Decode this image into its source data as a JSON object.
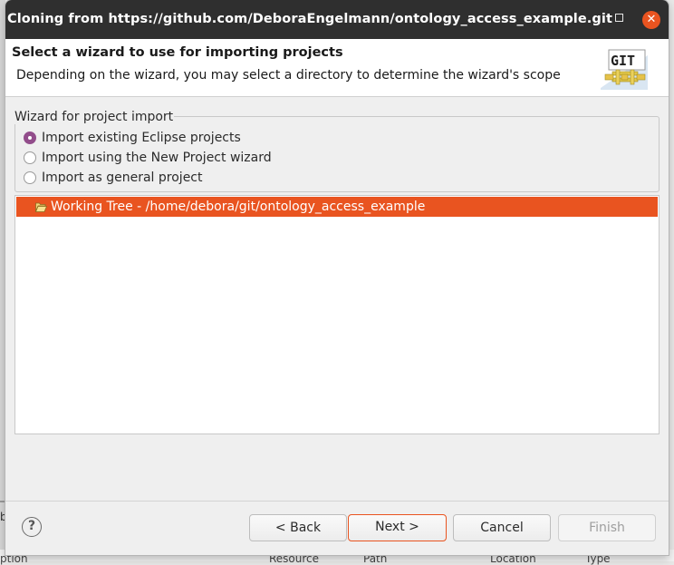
{
  "window": {
    "title": "Cloning from https://github.com/DeboraEngelmann/ontology_access_example.git",
    "close_glyph": "✕"
  },
  "header": {
    "title": "Select a wizard to use for importing projects",
    "description": "Depending on the wizard, you may select a directory to determine the wizard's scope",
    "logo_text": "GIT"
  },
  "group": {
    "legend": "Wizard for project import",
    "options": [
      {
        "label": "Import existing Eclipse projects",
        "selected": true
      },
      {
        "label": "Import using the New Project wizard",
        "selected": false
      },
      {
        "label": "Import as general project",
        "selected": false
      }
    ]
  },
  "tree": {
    "items": [
      {
        "label": "Working Tree - /home/debora/git/ontology_access_example",
        "icon": "folder-open-icon",
        "selected": true
      }
    ]
  },
  "buttons": {
    "help": "?",
    "back": "< Back",
    "next": "Next >",
    "cancel": "Cancel",
    "finish": "Finish"
  },
  "background": {
    "left_letter": "b",
    "columns": [
      "ption",
      "Resource",
      "Path",
      "Location",
      "Type"
    ]
  },
  "colors": {
    "accent": "#e95420",
    "radio_selected": "#924d8b",
    "titlebar": "#2f2f2f"
  }
}
